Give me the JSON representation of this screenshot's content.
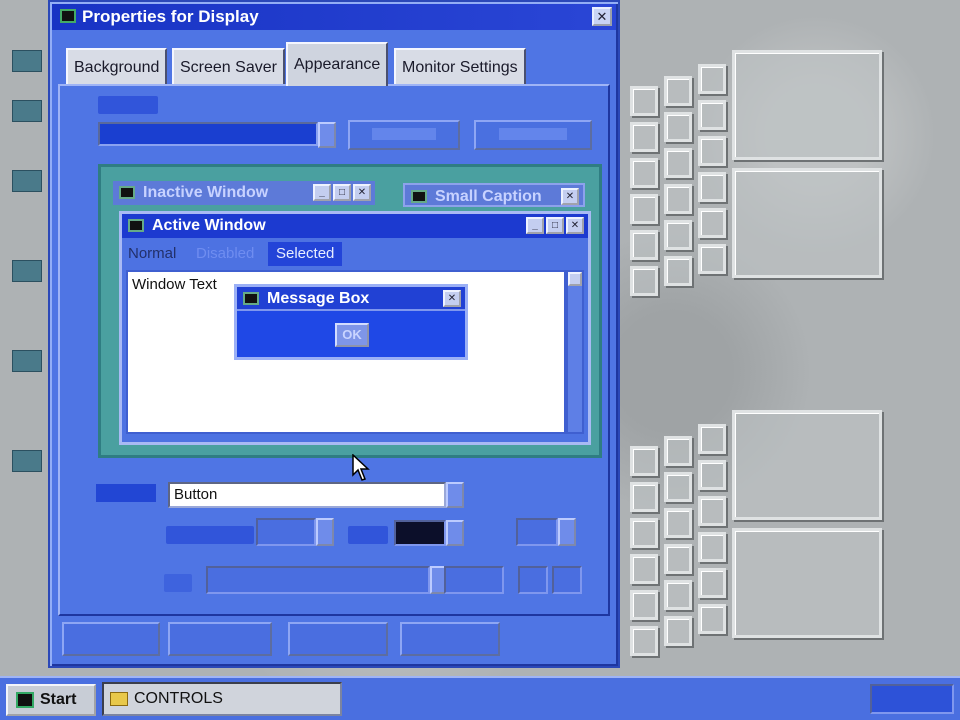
{
  "window": {
    "title": "Properties for Display",
    "close_glyph": "✕"
  },
  "tabs": [
    {
      "label": "Background",
      "active": false
    },
    {
      "label": "Screen Saver",
      "active": false
    },
    {
      "label": "Appearance",
      "active": true
    },
    {
      "label": "Monitor Settings",
      "active": false
    }
  ],
  "preview": {
    "inactive_window_title": "Inactive Window",
    "small_caption_title": "Small Caption",
    "active_window_title": "Active Window",
    "menu_items": [
      "Normal",
      "Disabled",
      "Selected"
    ],
    "window_text": "Window Text",
    "message_box_title": "Message Box",
    "ok_label": "OK"
  },
  "item": {
    "value": "Button"
  },
  "taskbar": {
    "start_label": "Start",
    "task_button_label": "CONTROLS"
  },
  "colors": {
    "dialog_bg": "#4f75e4",
    "titlebar": "#1833c4",
    "preview_desktop": "#4aa0a0",
    "message_box": "#1f48e6"
  }
}
